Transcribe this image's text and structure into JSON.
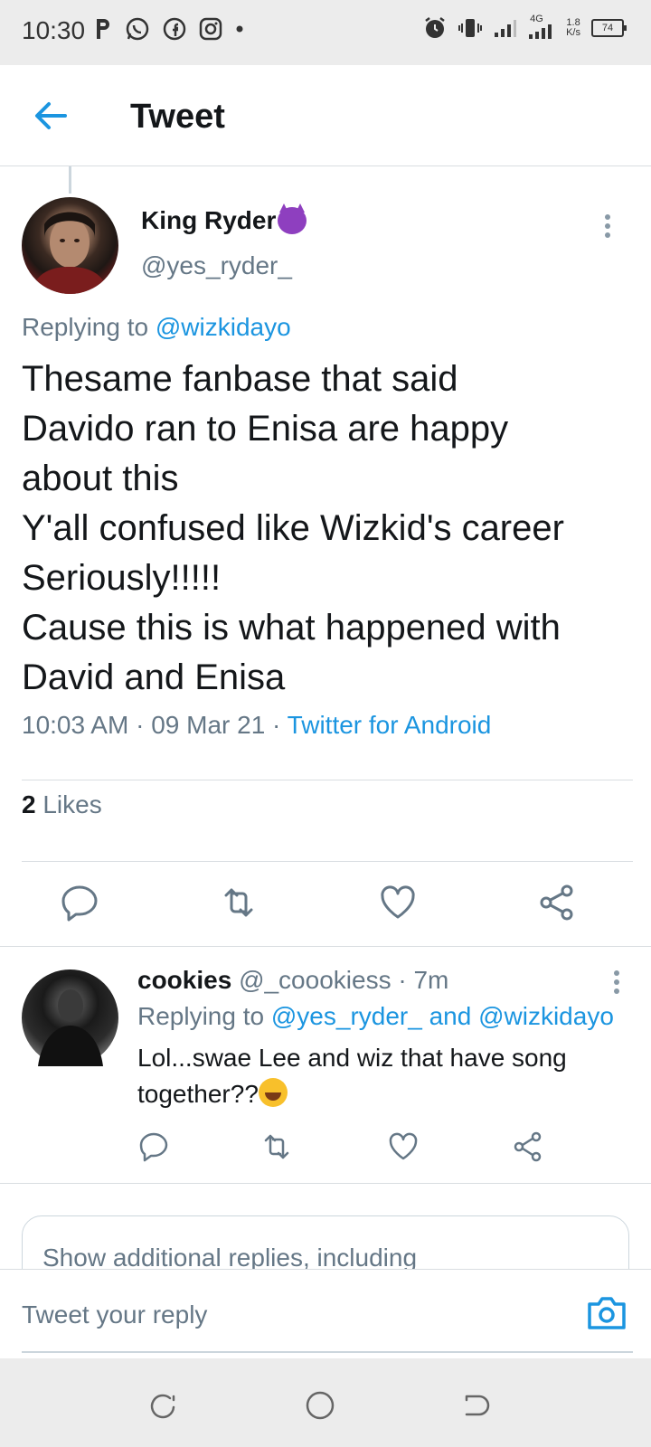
{
  "status_bar": {
    "time": "10:30",
    "network": "4G",
    "speed_value": "1.8",
    "speed_unit": "K/s",
    "battery": "74"
  },
  "header": {
    "title": "Tweet",
    "back_icon": "arrow-left-icon"
  },
  "main_tweet": {
    "name": "King Ryder",
    "name_emoji": "smiling-devil-emoji",
    "handle": "@yes_ryder_",
    "replying_prefix": "Replying to ",
    "replying_to": "@wizkidayo",
    "lines": [
      "Thesame fanbase that said",
      "Davido ran to Enisa are happy",
      "about this",
      "Y'all confused like Wizkid's career",
      "Seriously!!!!!",
      "Cause this is what happened with",
      "David and Enisa"
    ],
    "time": "10:03 AM",
    "date": "09 Mar 21",
    "separator": " · ",
    "source": "Twitter for Android",
    "likes_count": "2",
    "likes_label": "Likes"
  },
  "reply": {
    "name": "cookies",
    "handle": "@_coookiess",
    "age": "· 7m",
    "replying_prefix": "Replying to ",
    "replying_to": "@yes_ryder_ and @wizkidayo",
    "text_line1": "Lol...swae Lee and wiz that have song",
    "text_line2": "together??",
    "emoji": "laughing-tears-emoji"
  },
  "show_more": {
    "label": "Show additional replies, including"
  },
  "compose": {
    "placeholder": "Tweet your reply"
  },
  "colors": {
    "accent": "#1b95e0",
    "secondary_text": "#657786",
    "primary_text": "#14171a"
  }
}
